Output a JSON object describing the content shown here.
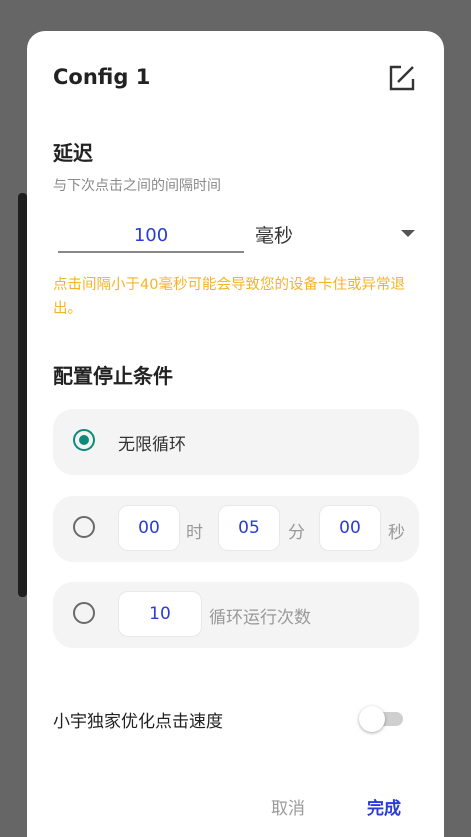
{
  "dialog": {
    "title": "Config 1",
    "delay": {
      "title": "延迟",
      "subtitle": "与下次点击之间的间隔时间",
      "value": "100",
      "unit": "毫秒",
      "warning": "点击间隔小于40毫秒可能会导致您的设备卡住或异常退出。"
    },
    "stop": {
      "title": "配置停止条件",
      "infinite_label": "无限循环",
      "timer": {
        "hours": "00",
        "hours_unit": "时",
        "minutes": "05",
        "minutes_unit": "分",
        "seconds": "00",
        "seconds_unit": "秒"
      },
      "count": {
        "value": "10",
        "label": "循环运行次数"
      },
      "selected": "infinite"
    },
    "optimize": {
      "label": "小宇独家优化点击速度",
      "enabled": false
    },
    "buttons": {
      "cancel": "取消",
      "done": "完成"
    }
  },
  "colors": {
    "accent": "#2a3bd6",
    "radio_checked": "#0e8a7a",
    "warning": "#f4b428",
    "overlay": "#666666"
  },
  "icons": {
    "edit": "edit-icon",
    "dropdown": "dropdown-arrow-icon"
  }
}
